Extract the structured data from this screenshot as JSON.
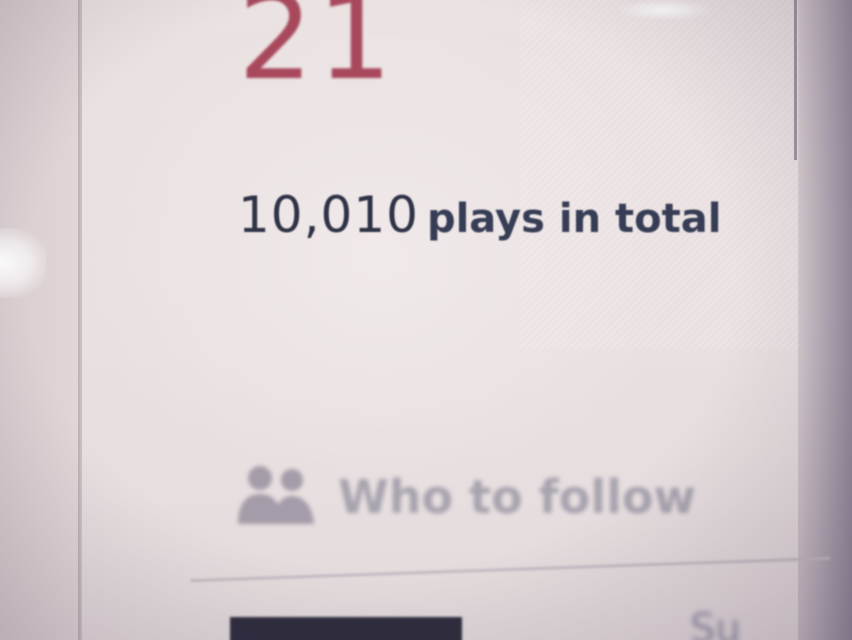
{
  "stats": {
    "count": "21",
    "plays_count": "10,010",
    "plays_label": "plays in total"
  },
  "who_to_follow": {
    "title": "Who to follow",
    "icon": "people-icon"
  },
  "partial": {
    "cut_text": "Su"
  },
  "colors": {
    "count": "#a8485c",
    "plays": "#2e3346",
    "follow_title": "#a7a3ae",
    "bottom_block": "#2d2b3d"
  }
}
